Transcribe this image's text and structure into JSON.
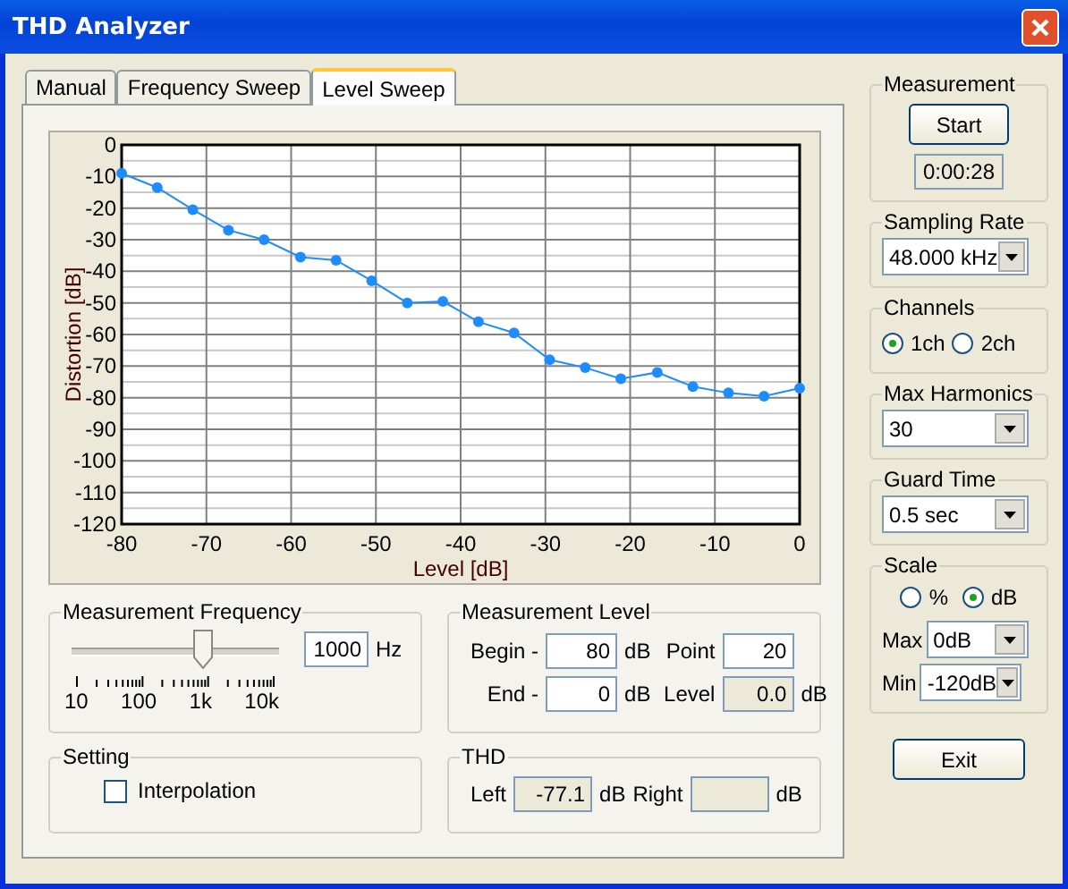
{
  "window": {
    "title": "THD Analyzer"
  },
  "tabs": [
    {
      "label": "Manual",
      "selected": false
    },
    {
      "label": "Frequency Sweep",
      "selected": false
    },
    {
      "label": "Level Sweep",
      "selected": true
    }
  ],
  "chart": {
    "chart_data": {
      "type": "line",
      "xlabel": "Level [dB]",
      "ylabel": "Distortion [dB]",
      "x": [
        -80,
        -75.8,
        -71.6,
        -67.4,
        -63.2,
        -58.9,
        -54.7,
        -50.5,
        -46.3,
        -42.1,
        -37.9,
        -33.7,
        -29.5,
        -25.3,
        -21.1,
        -16.8,
        -12.6,
        -8.4,
        -4.2,
        0
      ],
      "grid": true,
      "series": [
        {
          "color": "#1e8cff",
          "marker": true,
          "values": [
            -9,
            -13.5,
            -20.5,
            -27,
            -30,
            -35.5,
            -36.5,
            -43,
            -50,
            -49.5,
            -56,
            -59.5,
            -68,
            -70.5,
            -74,
            -72,
            -76.5,
            -78.5,
            -79.5,
            -77
          ]
        }
      ],
      "xlim": [
        -80,
        0
      ],
      "ylim": [
        -120,
        0
      ],
      "xticks": [
        -80,
        -70,
        -60,
        -50,
        -40,
        -30,
        -20,
        -10,
        0
      ],
      "yticks": [
        0,
        -10,
        -20,
        -30,
        -40,
        -50,
        -60,
        -70,
        -80,
        -90,
        -100,
        -110,
        -120
      ]
    }
  },
  "measurement_frequency": {
    "title": "Measurement Frequency",
    "level": 0.65,
    "scale_labels": [
      "10",
      "100",
      "1k",
      "10k"
    ],
    "value": "1000",
    "unit": "Hz"
  },
  "measurement_level": {
    "title": "Measurement Level",
    "fields": [
      {
        "label": "Begin -",
        "value": "80",
        "unit": "dB",
        "disabled": false
      },
      {
        "label": "Point",
        "value": "20",
        "disabled": false
      },
      {
        "label": "End -",
        "value": "0",
        "unit": "dB",
        "disabled": false
      },
      {
        "label": "Level",
        "value": "0.0",
        "unit": "dB",
        "disabled": true
      }
    ]
  },
  "setting": {
    "title": "Setting",
    "checkboxes": [
      {
        "label": "Interpolation",
        "checked": false
      }
    ]
  },
  "thd": {
    "title": "THD",
    "fields": [
      {
        "label": "Left",
        "value": "-77.1",
        "unit": "dB",
        "disabled": true
      },
      {
        "label": "Right",
        "unit": "dB",
        "disabled": true
      }
    ]
  },
  "measurement": {
    "title": "Measurement",
    "button": "Start",
    "elapsed": "0:00:28"
  },
  "sampling_rate": {
    "title": "Sampling Rate",
    "value": "48.000 kHz"
  },
  "channels": {
    "title": "Channels",
    "options": [
      {
        "label": "1ch",
        "selected": true
      },
      {
        "label": "2ch",
        "selected": false
      }
    ]
  },
  "max_harmonics": {
    "title": "Max Harmonics",
    "value": "30"
  },
  "guard_time": {
    "title": "Guard Time",
    "value": "0.5 sec"
  },
  "scale": {
    "title": "Scale",
    "options": [
      {
        "label": "%",
        "selected": false
      },
      {
        "label": "dB",
        "selected": true
      }
    ],
    "max": {
      "label": "Max",
      "value": "0dB"
    },
    "min": {
      "label": "Min",
      "value": "-120dB"
    }
  },
  "exit_button": "Exit"
}
